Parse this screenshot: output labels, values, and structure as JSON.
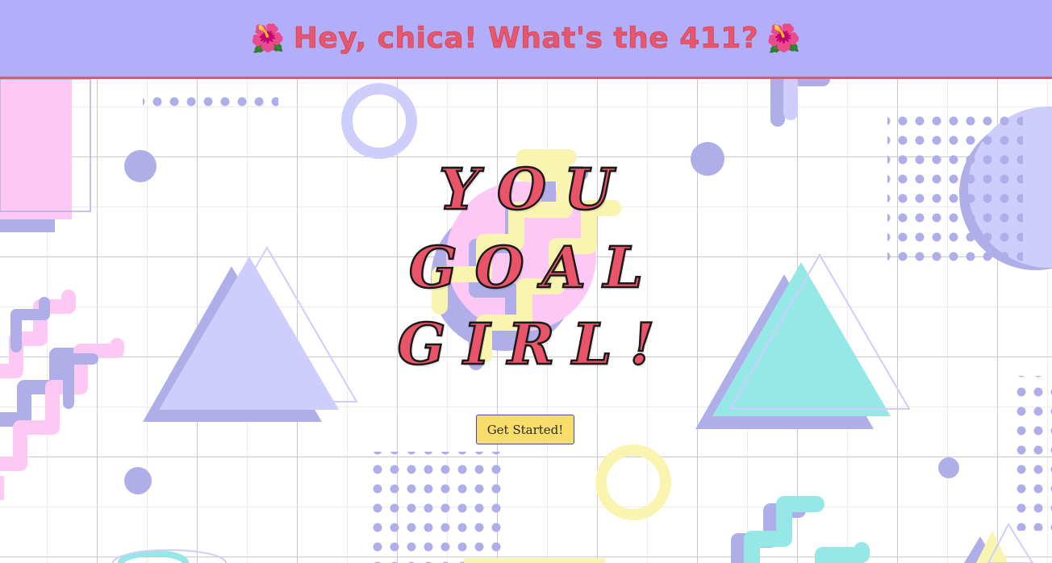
{
  "header": {
    "title": "Hey, chica! What's the 411?",
    "emoji_left": "🌺",
    "emoji_right": "🌺"
  },
  "hero": {
    "line1": "YOU",
    "line2": "GOAL",
    "line3": "GIRL!"
  },
  "cta": {
    "label": "Get Started!"
  },
  "colors": {
    "header_bg": "#b2aefa",
    "accent": "#e8566c",
    "lavender": "#b0aee8",
    "light_lavender": "#cfcdfb",
    "pink": "#fdc8f3",
    "yellow": "#f9f5b0",
    "mint": "#96e8e6",
    "button": "#f7de6a"
  }
}
